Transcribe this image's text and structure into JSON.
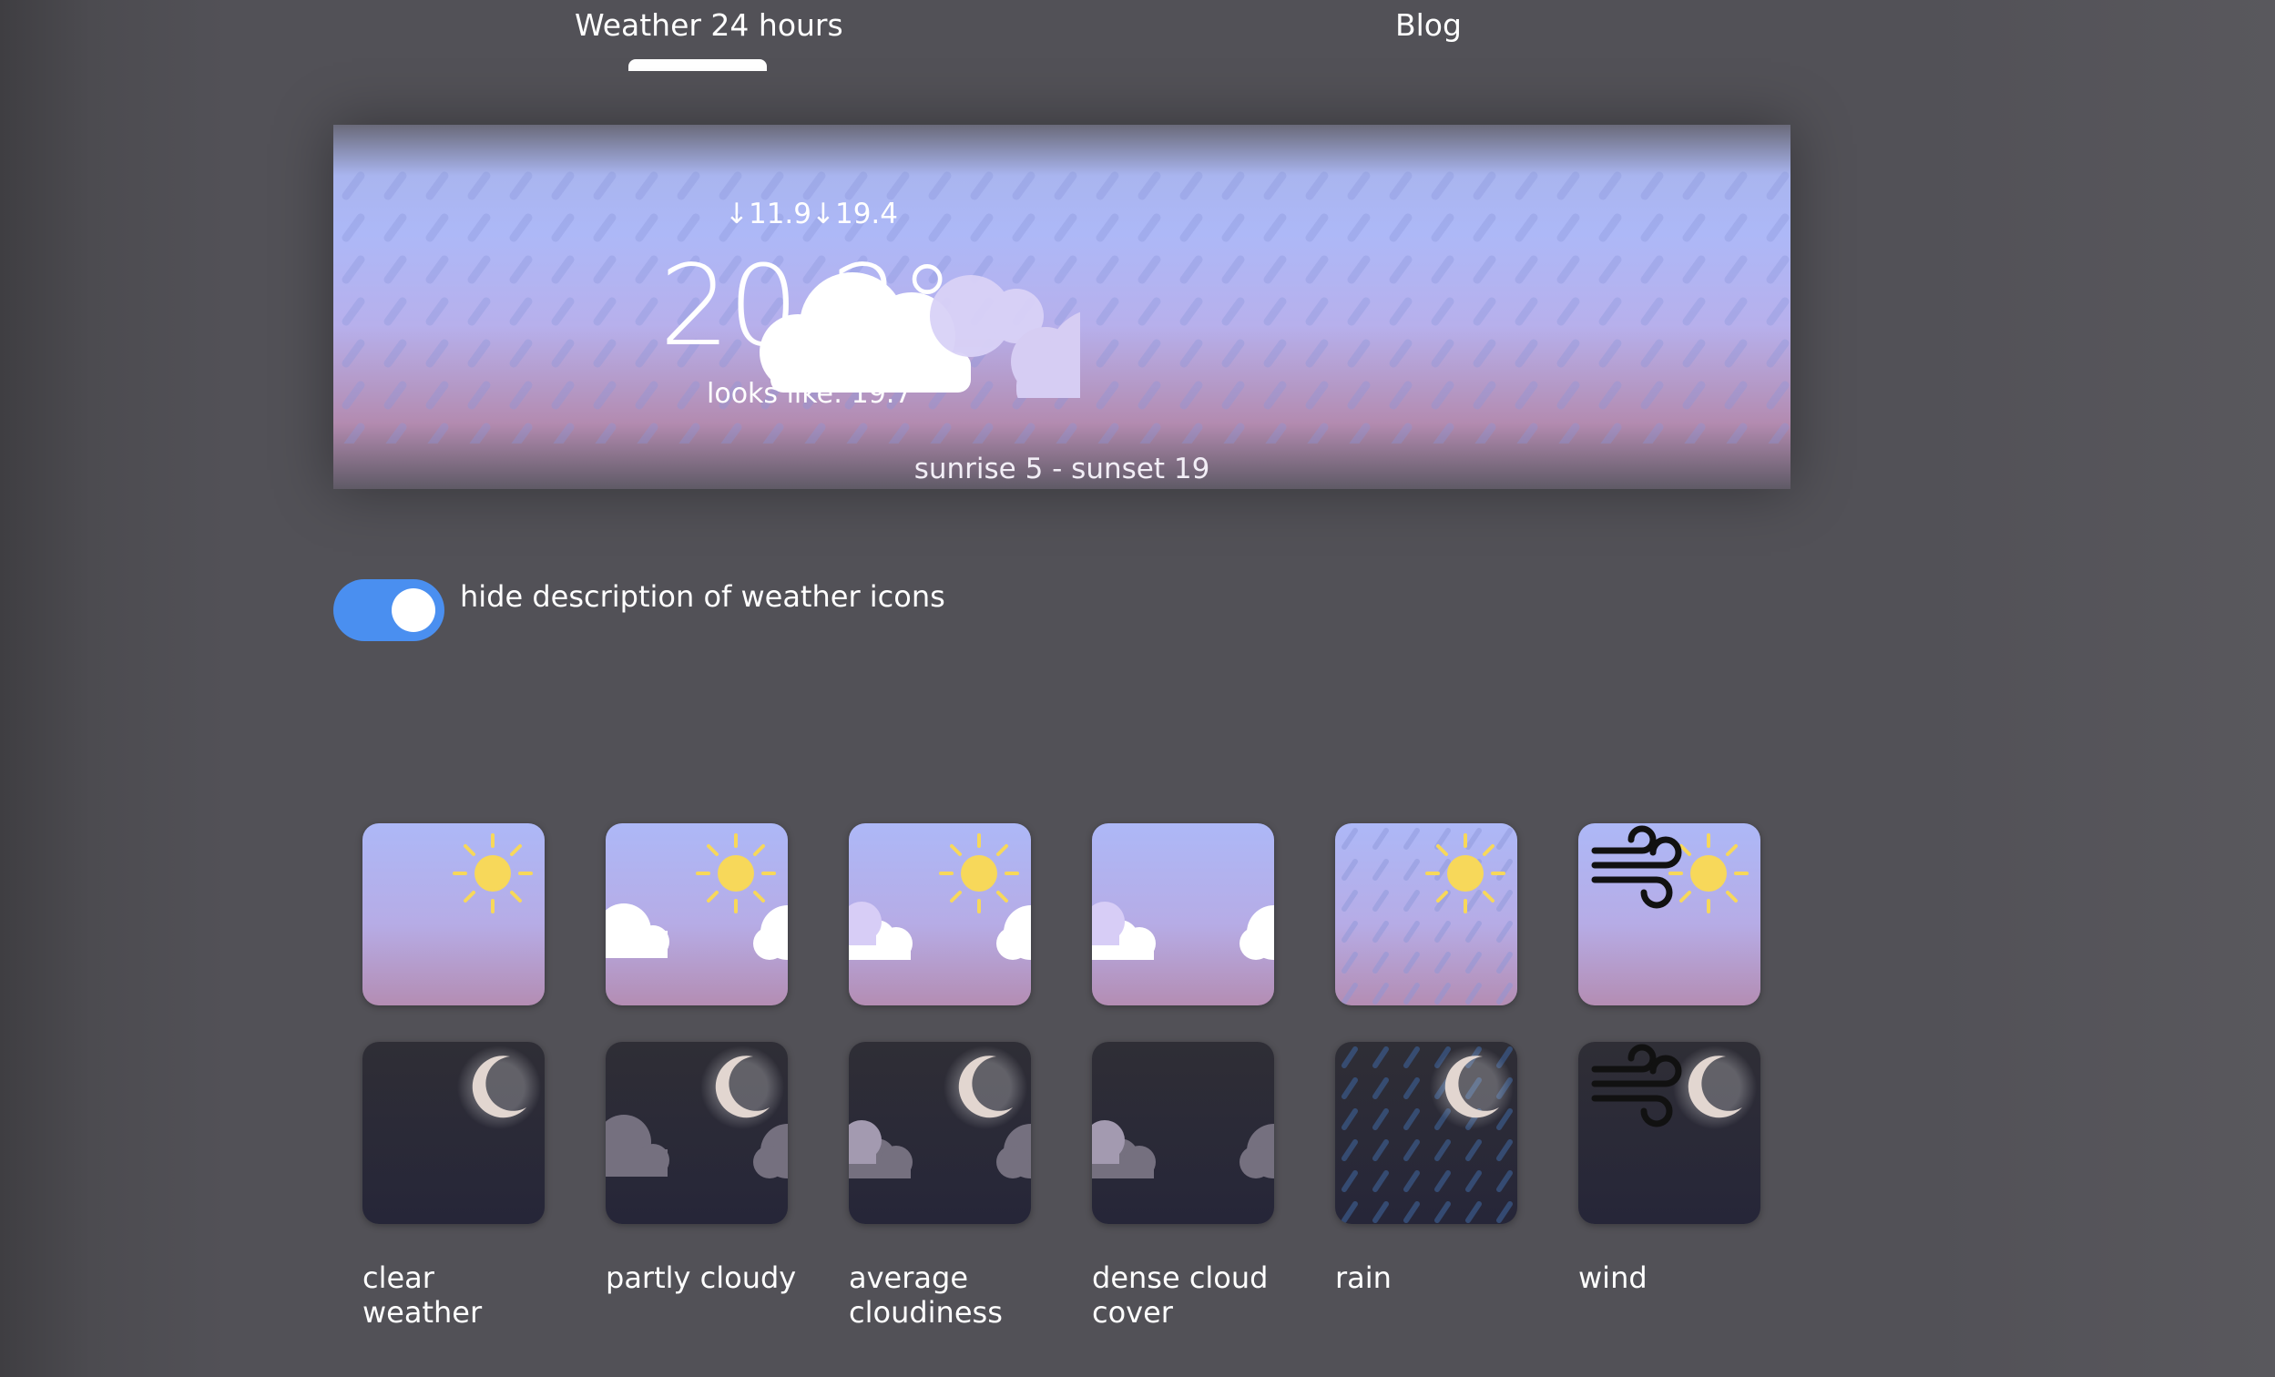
{
  "nav": {
    "tabs": [
      {
        "label": "Weather 24 hours",
        "active": true
      },
      {
        "label": "Blog",
        "active": false
      }
    ]
  },
  "hero": {
    "temp_range": "↓11.9↓19.4",
    "temperature": "20.2°",
    "feels_like": "looks like: 19.7",
    "sun_times": "sunrise 5 - sunset 19",
    "icon": "cloud-rain-icon"
  },
  "settings": {
    "toggle_label": "hide description of weather icons",
    "toggle_on": true,
    "accent_color": "#4a8ff0"
  },
  "legend": {
    "items": [
      {
        "label": "clear\nweather",
        "day_icon": "sun-icon",
        "night_icon": "moon-icon"
      },
      {
        "label": "partly cloudy",
        "day_icon": "sun-cloud-icon",
        "night_icon": "moon-cloud-icon"
      },
      {
        "label": "average\ncloudiness",
        "day_icon": "sun-clouds-icon",
        "night_icon": "moon-clouds-icon"
      },
      {
        "label": "dense cloud\ncover",
        "day_icon": "dense-clouds-icon",
        "night_icon": "dense-clouds-night-icon"
      },
      {
        "label": "rain",
        "day_icon": "sun-rain-icon",
        "night_icon": "moon-rain-icon"
      },
      {
        "label": "wind",
        "day_icon": "sun-wind-icon",
        "night_icon": "moon-wind-icon"
      }
    ]
  },
  "colors": {
    "day_sky_top": "#adb8f7",
    "day_sky_bottom": "#b38bb0",
    "night_sky_top": "#2f2e36",
    "night_sky_bottom": "#262638",
    "sun": "#f7d85a",
    "moon": "#e2d6d0"
  }
}
